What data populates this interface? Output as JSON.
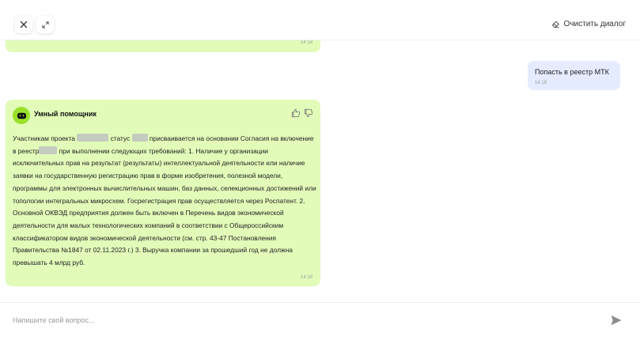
{
  "header": {
    "clear_label": "Очистить диалог"
  },
  "messages": {
    "prev_bot_time": "14:18",
    "user": {
      "text": "Попасть в реестр МТК",
      "time": "14:18"
    },
    "bot": {
      "name": "Умный помощник",
      "t1": "Участникам проекта",
      "t2": "статус",
      "t3": "присваивается на основании Согласия на включение в реестр",
      "t4": "при выполнении следующих требований: 1. Наличие у организации исключительных прав на результат (результаты) интеллектуальной деятельности или наличие заявки на государственную регистрацию прав в форме изобретения, полезной модели, программы для электронных вычислительных машин, баз данных, селекционных достижений или топологии интегральных микросхем. Госрегистрация прав осуществляется через Роспатент. 2. Основной ОКВЭД предприятия должен быть включен в Перечень видов экономической деятельности для малых технологических компаний в соответствии с Общероссийским классификатором видов экономической деятельности (см. стр. 43-47 Постановления Правительства №1847 от 02.11.2023 г.) 3. Выручка компании за прошедший год не должна превышать 4 млрд руб.",
      "time": "14:18"
    }
  },
  "composer": {
    "placeholder": "Напишите свой вопрос..."
  },
  "icons": {
    "close": "close-icon",
    "expand": "expand-icon",
    "clear": "eraser-icon",
    "bot": "bot-face-icon",
    "like": "thumbs-up-icon",
    "dislike": "thumbs-down-icon",
    "send": "send-icon"
  },
  "colors": {
    "bot_bubble": "#e2fbb9",
    "user_bubble": "#e5ecff",
    "bot_avatar": "#9be12b"
  }
}
